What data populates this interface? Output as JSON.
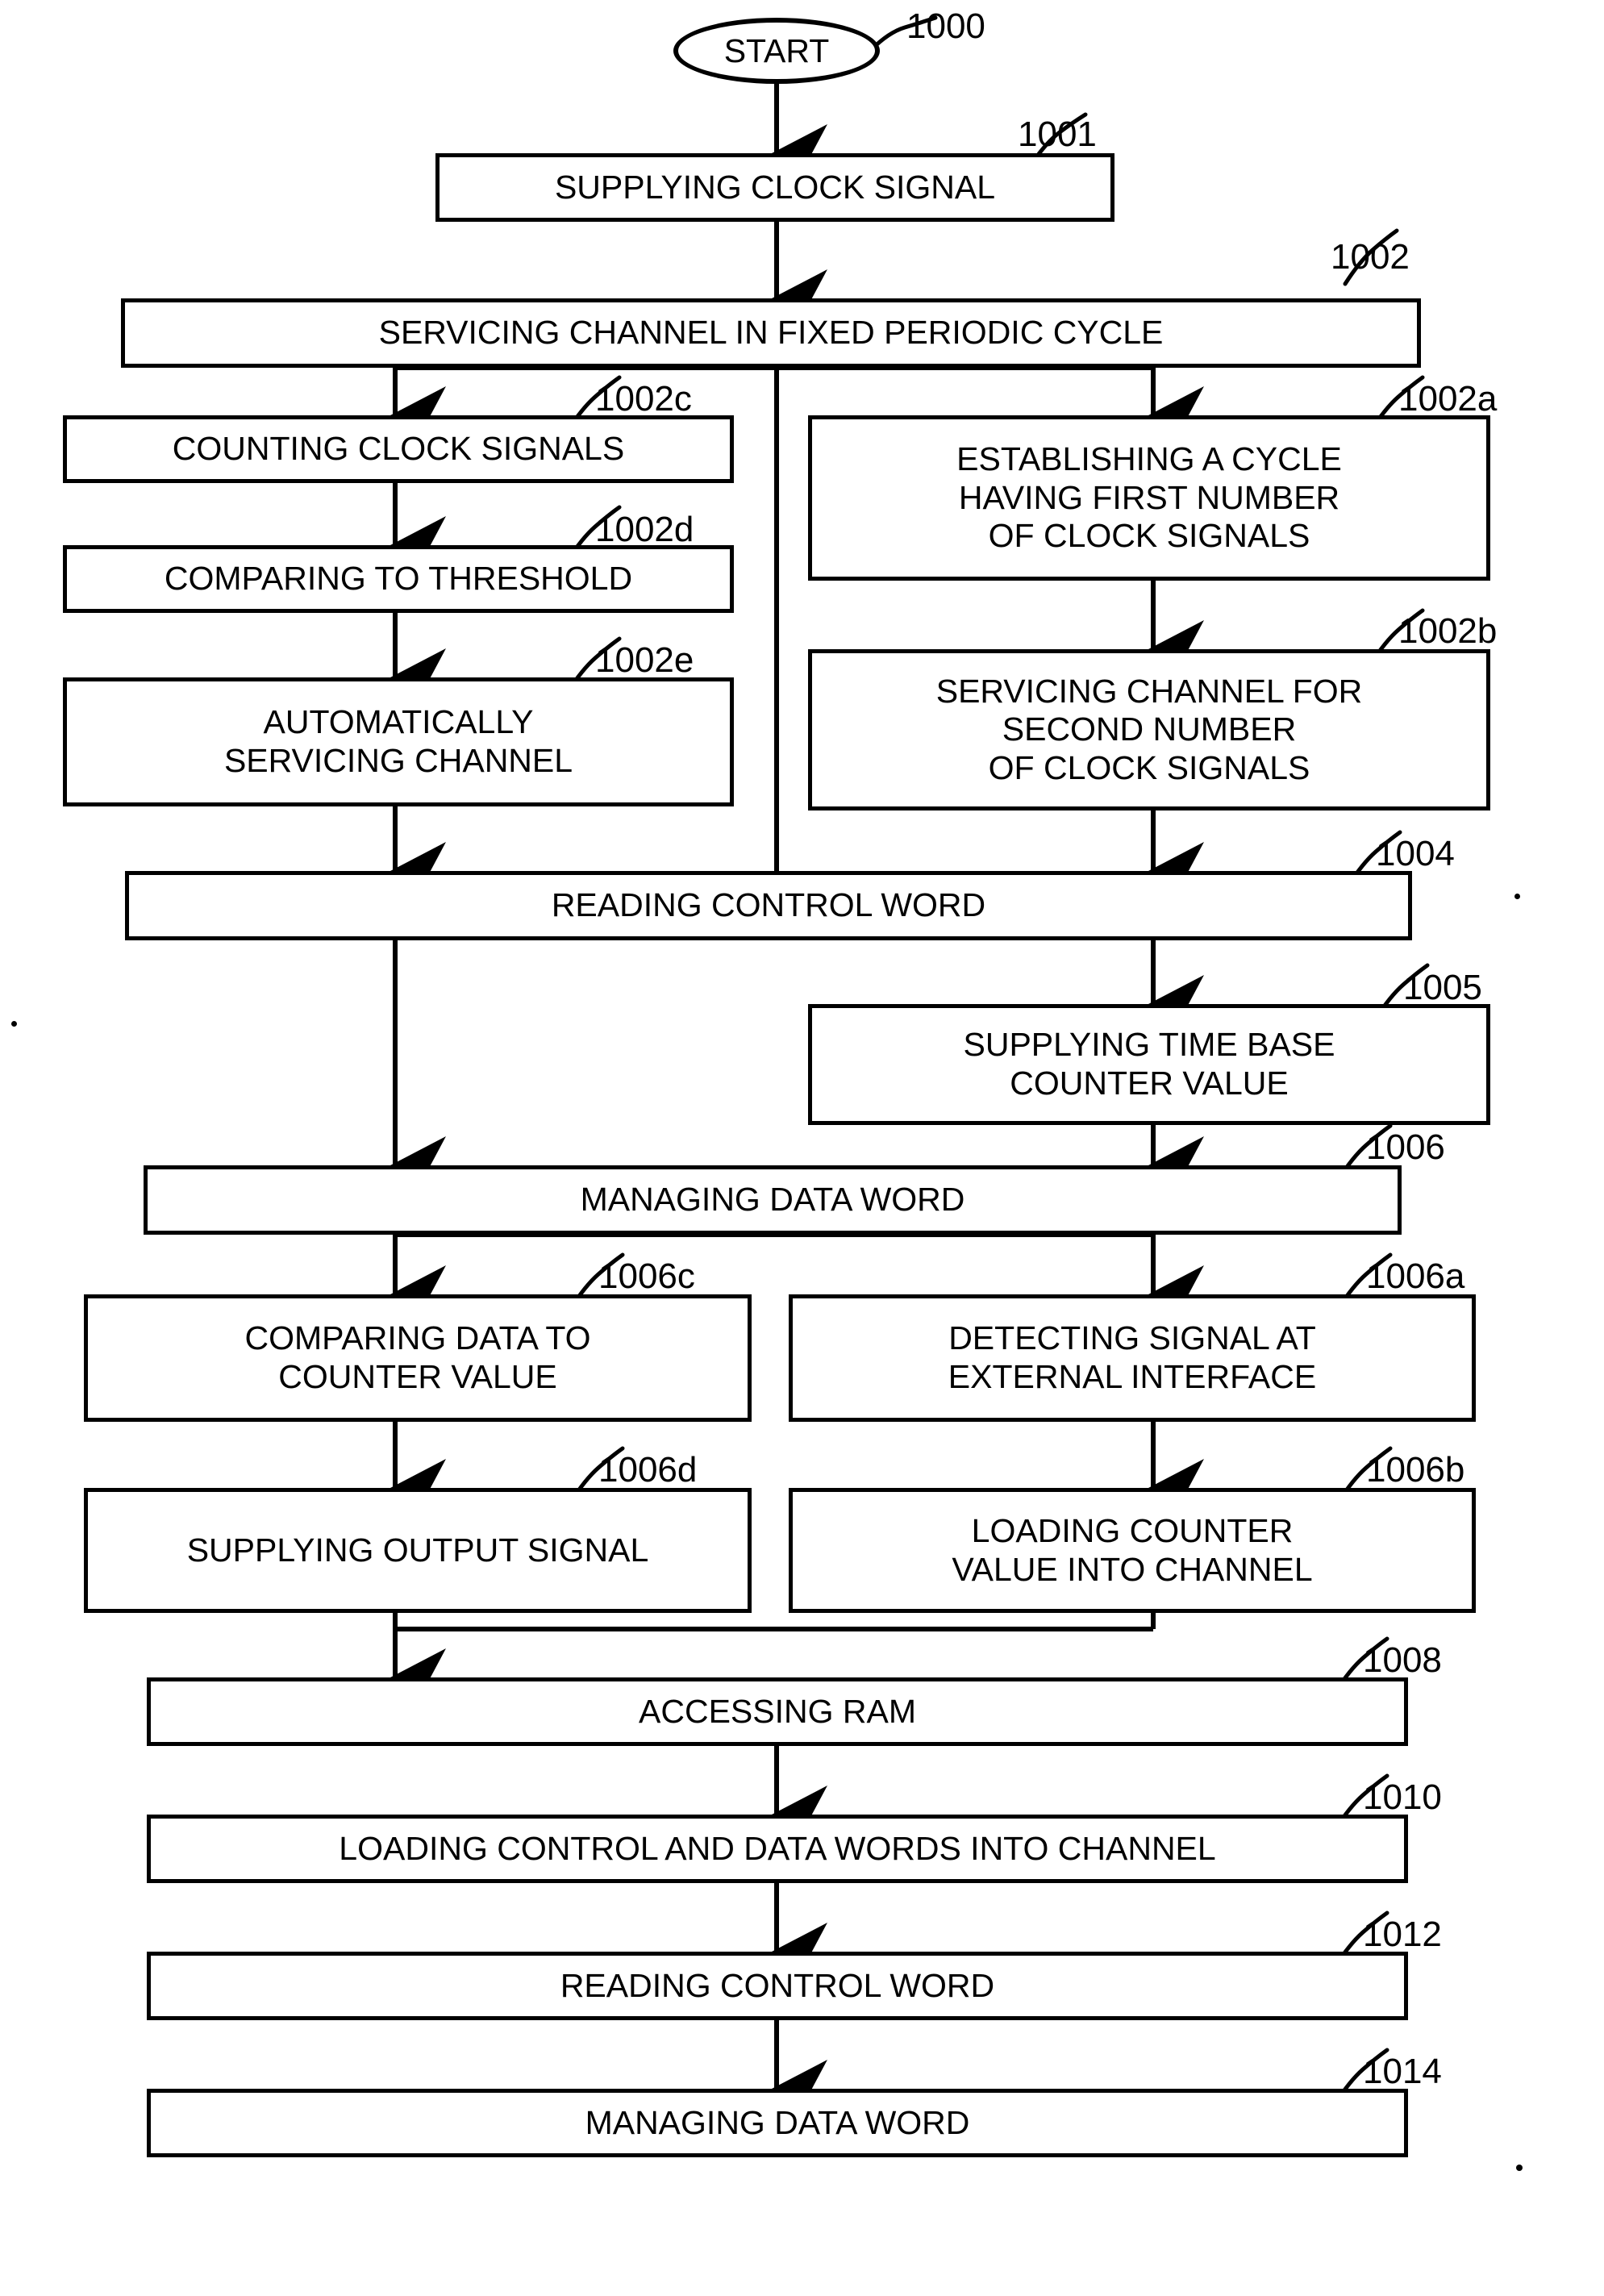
{
  "figure": {
    "type": "patent-flowchart",
    "orientation": "vertical"
  },
  "nodes": [
    {
      "id": "n1000",
      "ref": "1000",
      "shape": "oval",
      "label": "START",
      "lines": [
        "START"
      ]
    },
    {
      "id": "n1001",
      "ref": "1001",
      "shape": "rectangle",
      "label": "SUPPLYING CLOCK SIGNAL",
      "lines": [
        "SUPPLYING CLOCK SIGNAL"
      ]
    },
    {
      "id": "n1002",
      "ref": "1002",
      "shape": "rectangle",
      "label": "SERVICING CHANNEL IN FIXED PERIODIC CYCLE",
      "lines": [
        "SERVICING CHANNEL IN FIXED PERIODIC CYCLE"
      ]
    },
    {
      "id": "n1002c",
      "ref": "1002c",
      "shape": "rectangle",
      "label": "COUNTING CLOCK SIGNALS",
      "lines": [
        "COUNTING CLOCK SIGNALS"
      ]
    },
    {
      "id": "n1002d",
      "ref": "1002d",
      "shape": "rectangle",
      "label": "COMPARING TO THRESHOLD",
      "lines": [
        "COMPARING TO THRESHOLD"
      ]
    },
    {
      "id": "n1002e",
      "ref": "1002e",
      "shape": "rectangle",
      "label": "AUTOMATICALLY SERVICING CHANNEL",
      "lines": [
        "AUTOMATICALLY",
        "SERVICING CHANNEL"
      ]
    },
    {
      "id": "n1002a",
      "ref": "1002a",
      "shape": "rectangle",
      "label": "ESTABLISHING A CYCLE HAVING FIRST NUMBER OF CLOCK SIGNALS",
      "lines": [
        "ESTABLISHING A CYCLE",
        "HAVING FIRST NUMBER",
        "OF CLOCK SIGNALS"
      ]
    },
    {
      "id": "n1002b",
      "ref": "1002b",
      "shape": "rectangle",
      "label": "SERVICING CHANNEL FOR SECOND NUMBER OF CLOCK SIGNALS",
      "lines": [
        "SERVICING CHANNEL FOR",
        "SECOND NUMBER",
        "OF CLOCK SIGNALS"
      ]
    },
    {
      "id": "n1004",
      "ref": "1004",
      "shape": "rectangle",
      "label": "READING CONTROL WORD",
      "lines": [
        "READING CONTROL WORD"
      ]
    },
    {
      "id": "n1005",
      "ref": "1005",
      "shape": "rectangle",
      "label": "SUPPLYING TIME BASE COUNTER VALUE",
      "lines": [
        "SUPPLYING TIME BASE",
        "COUNTER VALUE"
      ]
    },
    {
      "id": "n1006",
      "ref": "1006",
      "shape": "rectangle",
      "label": "MANAGING DATA WORD",
      "lines": [
        "MANAGING DATA WORD"
      ]
    },
    {
      "id": "n1006c",
      "ref": "1006c",
      "shape": "rectangle",
      "label": "COMPARING DATA TO COUNTER VALUE",
      "lines": [
        "COMPARING DATA TO",
        "COUNTER VALUE"
      ]
    },
    {
      "id": "n1006a",
      "ref": "1006a",
      "shape": "rectangle",
      "label": "DETECTING SIGNAL AT EXTERNAL INTERFACE",
      "lines": [
        "DETECTING SIGNAL AT",
        "EXTERNAL INTERFACE"
      ]
    },
    {
      "id": "n1006d",
      "ref": "1006d",
      "shape": "rectangle",
      "label": "SUPPLYING OUTPUT SIGNAL",
      "lines": [
        "SUPPLYING OUTPUT SIGNAL"
      ]
    },
    {
      "id": "n1006b",
      "ref": "1006b",
      "shape": "rectangle",
      "label": "LOADING COUNTER VALUE INTO CHANNEL",
      "lines": [
        "LOADING COUNTER",
        "VALUE INTO CHANNEL"
      ]
    },
    {
      "id": "n1008",
      "ref": "1008",
      "shape": "rectangle",
      "label": "ACCESSING RAM",
      "lines": [
        "ACCESSING RAM"
      ]
    },
    {
      "id": "n1010",
      "ref": "1010",
      "shape": "rectangle",
      "label": "LOADING CONTROL AND DATA WORDS INTO CHANNEL",
      "lines": [
        "LOADING CONTROL AND DATA WORDS INTO CHANNEL"
      ]
    },
    {
      "id": "n1012",
      "ref": "1012",
      "shape": "rectangle",
      "label": "READING CONTROL WORD",
      "lines": [
        "READING CONTROL WORD"
      ]
    },
    {
      "id": "n1014",
      "ref": "1014",
      "shape": "rectangle",
      "label": "MANAGING DATA WORD",
      "lines": [
        "MANAGING DATA WORD"
      ]
    }
  ],
  "labels": {
    "n1000": "1000",
    "n1001": "1001",
    "n1002": "1002",
    "n1002a": "1002a",
    "n1002b": "1002b",
    "n1002c": "1002c",
    "n1002d": "1002d",
    "n1002e": "1002e",
    "n1004": "1004",
    "n1005": "1005",
    "n1006": "1006",
    "n1006a": "1006a",
    "n1006b": "1006b",
    "n1006c": "1006c",
    "n1006d": "1006d",
    "n1008": "1008",
    "n1010": "1010",
    "n1012": "1012",
    "n1014": "1014"
  },
  "text": {
    "start": "START",
    "supplying_clock_signal": "SUPPLYING CLOCK SIGNAL",
    "servicing_channel_fixed": "SERVICING CHANNEL IN FIXED PERIODIC CYCLE",
    "counting_clock_signals": "COUNTING CLOCK SIGNALS",
    "comparing_to_threshold": "COMPARING TO THRESHOLD",
    "automatically_1": "AUTOMATICALLY",
    "automatically_2": "SERVICING CHANNEL",
    "establishing_1": "ESTABLISHING A CYCLE",
    "establishing_2": "HAVING FIRST NUMBER",
    "establishing_3": "OF CLOCK SIGNALS",
    "servicing_second_1": "SERVICING CHANNEL FOR",
    "servicing_second_2": "SECOND NUMBER",
    "servicing_second_3": "OF CLOCK SIGNALS",
    "reading_control_word_1004": "READING CONTROL WORD",
    "supplying_timebase_1": "SUPPLYING TIME BASE",
    "supplying_timebase_2": "COUNTER VALUE",
    "managing_data_word_1006": "MANAGING DATA WORD",
    "comparing_data_1": "COMPARING DATA TO",
    "comparing_data_2": "COUNTER VALUE",
    "detecting_signal_1": "DETECTING SIGNAL AT",
    "detecting_signal_2": "EXTERNAL INTERFACE",
    "supplying_output_signal": "SUPPLYING OUTPUT SIGNAL",
    "loading_counter_1": "LOADING COUNTER",
    "loading_counter_2": "VALUE INTO CHANNEL",
    "accessing_ram": "ACCESSING RAM",
    "loading_control_data": "LOADING CONTROL AND DATA WORDS INTO CHANNEL",
    "reading_control_word_1012": "READING CONTROL WORD",
    "managing_data_word_1014": "MANAGING DATA WORD"
  },
  "colors": {
    "ink": "#000000",
    "paper": "#ffffff"
  }
}
